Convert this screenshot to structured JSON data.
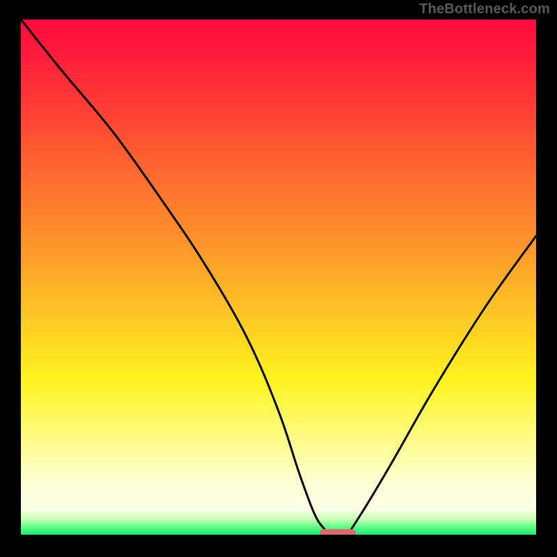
{
  "watermark": "TheBottleneck.com",
  "colors": {
    "frame_bg": "#000000",
    "watermark": "#5a5a5a",
    "curve_stroke": "#000000",
    "marker_fill": "#d96a6e"
  },
  "chart_data": {
    "type": "line",
    "title": "",
    "xlabel": "",
    "ylabel": "",
    "xlim": [
      0,
      100
    ],
    "ylim": [
      0,
      100
    ],
    "grid": false,
    "legend": false,
    "annotations": [
      "TheBottleneck.com"
    ],
    "series": [
      {
        "name": "bottleneck-curve",
        "x": [
          0,
          8,
          18,
          28,
          36,
          44,
          50,
          54,
          57,
          59,
          60,
          63,
          66,
          72,
          80,
          90,
          100
        ],
        "y": [
          100,
          90,
          78,
          64,
          52,
          38,
          24,
          12,
          4,
          1,
          0,
          0,
          4,
          14,
          28,
          44,
          58
        ]
      }
    ],
    "minimum_marker": {
      "x_range": [
        58,
        65
      ],
      "y": 0
    }
  }
}
